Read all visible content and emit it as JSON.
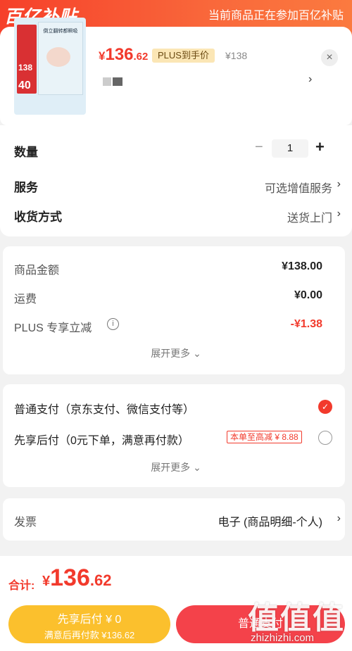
{
  "header": {
    "brand": "百亿补贴",
    "notice": "当前商品正在参加百亿补贴"
  },
  "product": {
    "thumb_title": "倒立翻转都瞬吸",
    "thumb_price_a": "138",
    "thumb_price_b": "40",
    "price_currency": "¥",
    "price_int": "136",
    "price_dec": ".62",
    "plus_tag": "PLUS到手价",
    "original_price": "¥138",
    "close": "×",
    "chevron": "›"
  },
  "options": {
    "quantity_label": "数量",
    "quantity_minus": "−",
    "quantity_value": "1",
    "quantity_plus": "+",
    "service_label": "服务",
    "service_value": "可选增值服务",
    "delivery_label": "收货方式",
    "delivery_value": "送货上门",
    "chevron": "›"
  },
  "fees": {
    "goods_label": "商品金额",
    "goods_value": "¥138.00",
    "shipping_label": "运费",
    "shipping_value": "¥0.00",
    "plus_label": "PLUS 专享立减",
    "plus_info": "i",
    "plus_value": "-¥1.38",
    "expand": "展开更多 ⌄"
  },
  "payment": {
    "normal_label": "普通支付（京东支付、微信支付等）",
    "normal_check": "✓",
    "later_label": "先享后付（0元下单，满意再付款）",
    "later_tag": "本单至高减 ¥ 8.88",
    "expand": "展开更多 ⌄"
  },
  "invoice": {
    "label": "发票",
    "value": "电子 (商品明细-个人)",
    "chevron": "›"
  },
  "footer": {
    "total_label": "合计:",
    "total_currency": "¥",
    "total_int": "136",
    "total_dec": ".62",
    "later_btn_line1": "先享后付 ¥ 0",
    "later_btn_line2": "满意后再付款 ¥136.62",
    "pay_btn": "普通支付",
    "watermark": "值值值",
    "watermark_url": "zhizhizhi.com"
  },
  "colors": {
    "accent": "#f23a2c",
    "plus_gold": "#fbe6b5",
    "later_button": "#fbc02d",
    "pay_button": "#f4424a"
  }
}
